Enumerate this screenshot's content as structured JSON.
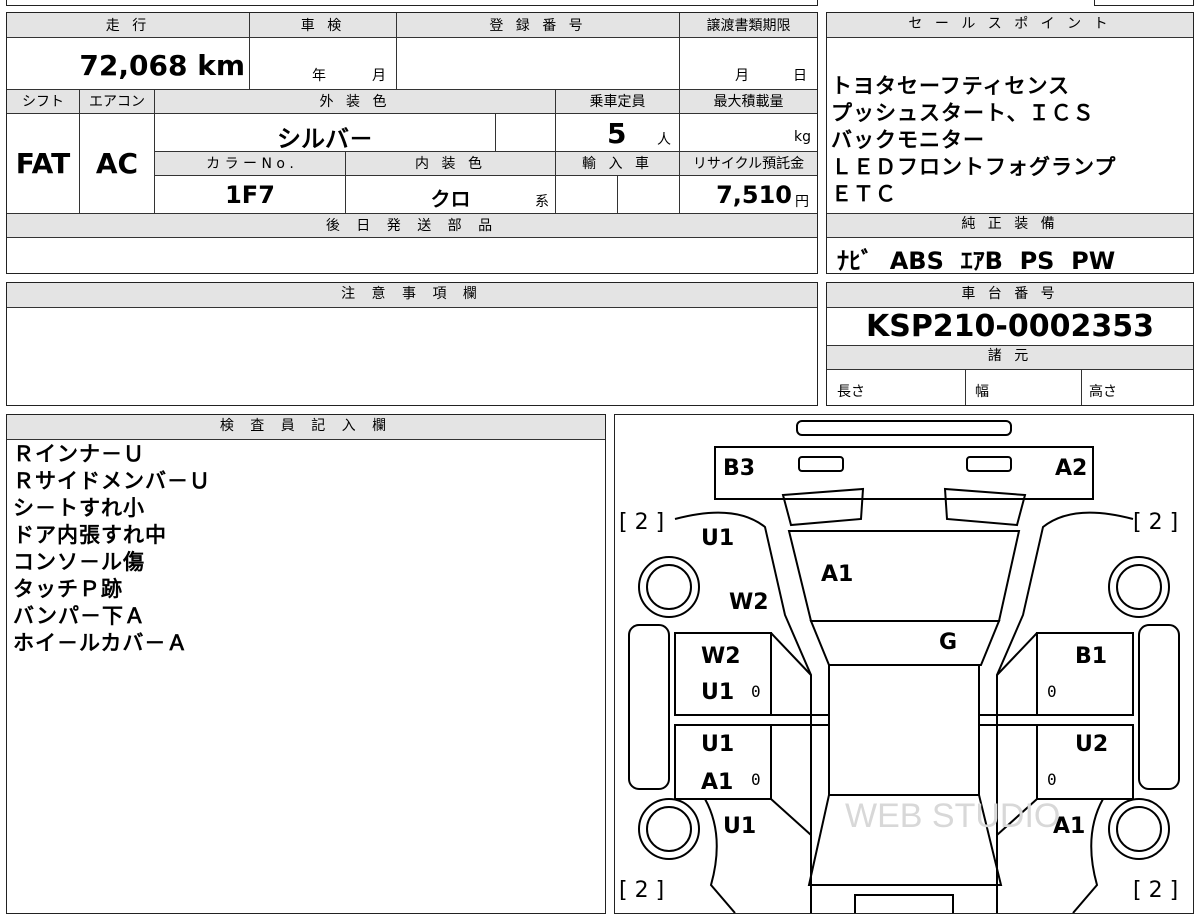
{
  "left_table": {
    "h_mileage": "走 行",
    "h_inspection": "車 検",
    "h_registration": "登 録 番 号",
    "h_transfer_deadline": "譲渡書類期限",
    "mileage": "72,068 km",
    "insp_year": "年",
    "insp_month": "月",
    "deadline_month": "月",
    "deadline_day": "日",
    "h_shift": "シフト",
    "h_aircon": "エアコン",
    "h_exterior_color": "外 装 色",
    "h_capacity": "乗車定員",
    "h_max_load": "最大積載量",
    "shift": "FAT",
    "aircon": "AC",
    "exterior_color": "シルバ－",
    "capacity": "5",
    "capacity_unit": "人",
    "max_load_unit": "kg",
    "h_color_no": "カ ラ ー N o .",
    "h_interior_color": "内 装 色",
    "h_import": "輸 入 車",
    "h_recycle": "リサイクル預託金",
    "color_no": "1F7",
    "interior_color": "クロ",
    "interior_suffix": "系",
    "recycle_fee": "7,510",
    "recycle_unit": "円",
    "h_later_parts": "後 日 発 送 部 品",
    "h_notes": "注 意 事 項 欄"
  },
  "sales_points": {
    "header": "セ ー ル ス ポ イ ン ト",
    "lines": [
      "トヨタセーフティセンス",
      "プッシュスタート、ＩＣＳ",
      "バックモニター",
      "ＬＥＤフロントフォグランプ",
      "ＥＴＣ"
    ]
  },
  "genuine_equipment": {
    "header": "純 正 装 備",
    "value": "ﾅﾋﾞ  ABS  ｴｱB  PS  PW"
  },
  "chassis": {
    "header": "車 台 番 号",
    "value": "KSP210-0002353"
  },
  "specs": {
    "header": "諸 元",
    "length": "長さ",
    "width": "幅",
    "height": "高さ"
  },
  "inspector": {
    "header": "検 査 員 記 入 欄",
    "lines": [
      "Ｒインナ－Ｕ",
      "Ｒサイドメンバ－Ｕ",
      "シ－トすれ小",
      "ドア内張すれ中",
      "コンソ－ル傷",
      "タッチＰ跡",
      "バンパ－下Ａ",
      "ホイ－ルカバ－Ａ"
    ]
  },
  "diagram": {
    "labels": {
      "rear_left": "B3",
      "rear_right": "A2",
      "rear_glass": "A1",
      "left_quarter_u": "U1",
      "left_quarter_w": "W2",
      "roof": "G",
      "left_rear_door_w": "W2",
      "left_rear_door_u": "U1",
      "right_rear_door": "B1",
      "left_front_door_u": "U1",
      "left_front_door_a": "A1",
      "right_front_door": "U2",
      "left_front_fender": "U1",
      "right_front_fender": "A1"
    },
    "tire_markers": [
      "[ 2 ]",
      "[ 2 ]",
      "[ 2 ]",
      "[ 2 ]"
    ],
    "zero_marks": [
      "0",
      "0",
      "0",
      "0"
    ],
    "watermark": "WEB STUDIO"
  }
}
